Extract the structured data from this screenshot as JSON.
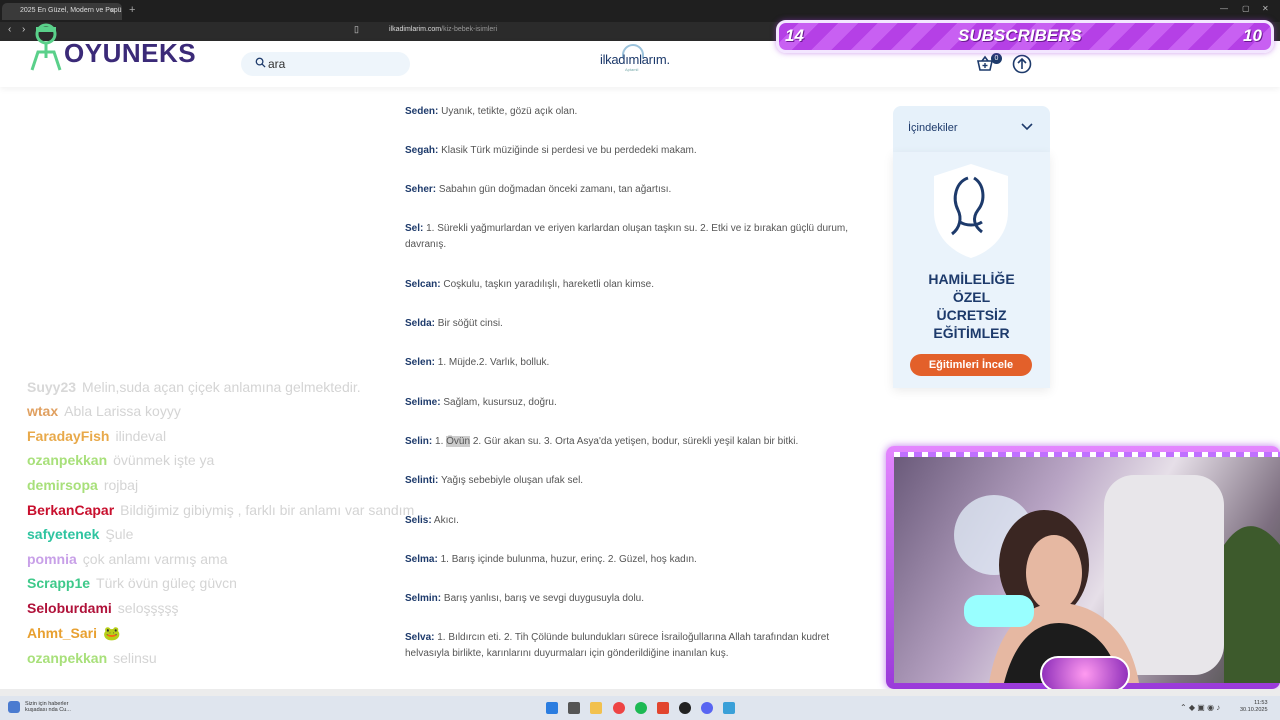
{
  "browser": {
    "tab_title": "2025 En Güzel, Modern ve Popü",
    "tab_close": "×",
    "new_tab": "+",
    "url_domain": "ilkadimlarim.com",
    "url_path": "/kiz-bebek-isimleri"
  },
  "site": {
    "search_placeholder": "ara",
    "brand_name": "ilkadımlarım.",
    "brand_tagline": "Aptamil",
    "basket_count": "0"
  },
  "stream": {
    "logo_text": "OYUNEKS",
    "sub_left": "14",
    "sub_label": "SUBSCRIBERS",
    "sub_right": "10"
  },
  "entries": [
    {
      "name": "Seden:",
      "meaning": "Uyanık, tetikte, gözü açık olan."
    },
    {
      "name": "Segah:",
      "meaning": "Klasik Türk müziğinde si perdesi ve bu perdedeki makam."
    },
    {
      "name": "Seher:",
      "meaning": "Sabahın gün doğmadan önceki zamanı, tan ağartısı."
    },
    {
      "name": "Sel:",
      "meaning": "1. Sürekli yağmurlardan ve eriyen karlardan oluşan taşkın su. 2. Etki ve iz bırakan güçlü durum, davranış."
    },
    {
      "name": "Selcan:",
      "meaning": "Coşkulu, taşkın yaradılışlı, hareketli olan kimse."
    },
    {
      "name": "Selda:",
      "meaning": "Bir söğüt cinsi."
    },
    {
      "name": "Selen:",
      "meaning": "1. Müjde.2. Varlık, bolluk."
    },
    {
      "name": "Selime:",
      "meaning": "Sağlam, kusursuz, doğru."
    },
    {
      "name": "Selin:",
      "meaning_pre": "1. ",
      "meaning_hl": "Övün",
      "meaning_post": " 2. Gür akan su. 3. Orta Asya'da yetişen, bodur, sürekli yeşil kalan bir bitki."
    },
    {
      "name": "Selinti:",
      "meaning": "Yağış sebebiyle oluşan ufak sel."
    },
    {
      "name": "Selis:",
      "meaning": "Akıcı."
    },
    {
      "name": "Selma:",
      "meaning": "1. Barış içinde bulunma, huzur, erinç. 2. Güzel, hoş kadın."
    },
    {
      "name": "Selmin:",
      "meaning": "Barış yanlısı, barış ve sevgi duygusuyla dolu."
    },
    {
      "name": "Selva:",
      "meaning": "1. Bıldırcın eti. 2. Tih Çölünde bulundukları sürece İsrailoğullarına Allah tarafından kudret helvasıyla birlikte, karınlarını duyurmaları için gönderildiğine inanılan kuş."
    }
  ],
  "sidebar": {
    "toc_label": "İçindekiler",
    "promo_title_1": "HAMİLELİĞE",
    "promo_title_2": "ÖZEL",
    "promo_title_3": "ÜCRETSİZ",
    "promo_title_4": "EĞİTİMLER",
    "promo_button": "Eğitimleri İncele"
  },
  "chat": [
    {
      "user": "Suyy23",
      "msg": "Melin,suda açan çiçek anlamına gelmektedir.",
      "color": "#d8d8d8"
    },
    {
      "user": "wtax",
      "msg": "Abla Larissa koyyy",
      "color": "#e0a060"
    },
    {
      "user": "FaradayFish",
      "msg": "ilindeval",
      "color": "#e8a94a"
    },
    {
      "user": "ozanpekkan",
      "msg": "övünmek işte ya",
      "color": "#a8e07a"
    },
    {
      "user": "demirsopa",
      "msg": "rojbaj",
      "color": "#a8e07a"
    },
    {
      "user": "BerkanCapar",
      "msg": "Bildiğimiz gibiymiş , farklı bir anlamı var sandım",
      "color": "#c8102e"
    },
    {
      "user": "safyetenek",
      "msg": "Şule",
      "color": "#2ec4a0"
    },
    {
      "user": "pomnia",
      "msg": "çok anlamı varmış ama",
      "color": "#c8a0e8"
    },
    {
      "user": "Scrapp1e",
      "msg": "Türk övün güleç güvcn",
      "color": "#3ec98a"
    },
    {
      "user": "Seloburdami",
      "msg": "seloşşşşş",
      "color": "#b0123a"
    },
    {
      "user": "Ahmt_Sari",
      "msg": "🐸",
      "color": "#e8a030"
    },
    {
      "user": "ozanpekkan",
      "msg": "selinsu",
      "color": "#a8e07a"
    }
  ],
  "taskbar": {
    "news_line1": "Sizin için haberler",
    "news_line2": "kuşadası nda Cu...",
    "time": "11:53",
    "date": "30.10.2025"
  },
  "colors": {
    "brand_navy": "#1d3a6b",
    "promo_orange": "#e3602a",
    "sub_purple": "#b540e6"
  }
}
